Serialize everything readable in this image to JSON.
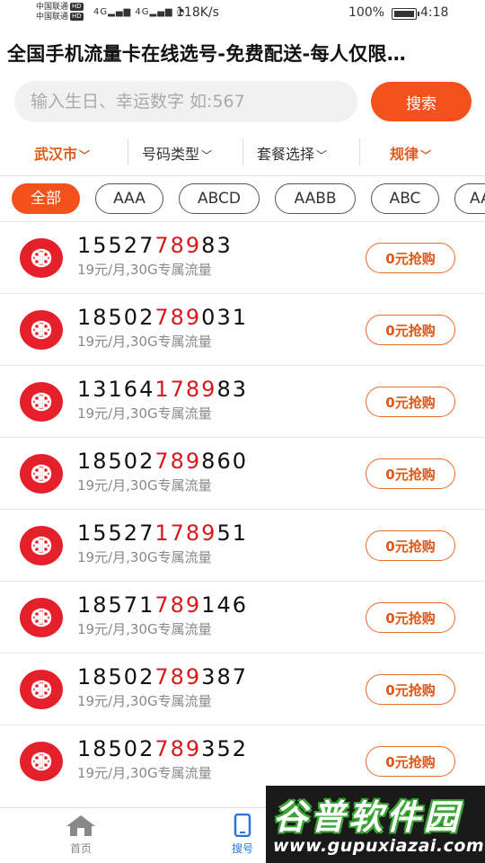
{
  "status_bar": {
    "carrier1": "中国联通",
    "carrier2": "中国联通",
    "hd": "HD",
    "net": "4G",
    "speed": "118K/s",
    "battery": "100%",
    "time": "4:18"
  },
  "title": "全国手机流量卡在线选号-免费配送-每人仅限…",
  "search": {
    "placeholder": "输入生日、幸运数字 如:567",
    "button": "搜索"
  },
  "filters": [
    {
      "label": "武汉市",
      "active": true
    },
    {
      "label": "号码类型",
      "active": false
    },
    {
      "label": "套餐选择",
      "active": false
    },
    {
      "label": "规律",
      "active": true
    }
  ],
  "chips": [
    "全部",
    "AAA",
    "ABCD",
    "AABB",
    "ABC",
    "AA"
  ],
  "rows": [
    {
      "pre": "15527",
      "hl": "789",
      "post": "83",
      "plan": "19元/月,30G专属流量",
      "btn": "0元抢购"
    },
    {
      "pre": "18502",
      "hl": "789",
      "post": "031",
      "plan": "19元/月,30G专属流量",
      "btn": "0元抢购"
    },
    {
      "pre": "13164",
      "hl": "1789",
      "post": "83",
      "plan": "19元/月,30G专属流量",
      "btn": "0元抢购"
    },
    {
      "pre": "18502",
      "hl": "789",
      "post": "860",
      "plan": "19元/月,30G专属流量",
      "btn": "0元抢购"
    },
    {
      "pre": "15527",
      "hl": "1789",
      "post": "51",
      "plan": "19元/月,30G专属流量",
      "btn": "0元抢购"
    },
    {
      "pre": "18571",
      "hl": "789",
      "post": "146",
      "plan": "19元/月,30G专属流量",
      "btn": "0元抢购"
    },
    {
      "pre": "18502",
      "hl": "789",
      "post": "387",
      "plan": "19元/月,30G专属流量",
      "btn": "0元抢购"
    },
    {
      "pre": "18502",
      "hl": "789",
      "post": "352",
      "plan": "19元/月,30G专属流量",
      "btn": "0元抢购"
    }
  ],
  "tabs": [
    {
      "label": "首页",
      "icon": "home-icon"
    },
    {
      "label": "搜号",
      "icon": "phone-icon"
    }
  ],
  "watermark": {
    "cn": "谷普软件园",
    "en": "www.gupuxiazai.com"
  },
  "colors": {
    "accent": "#f4521c",
    "highlight": "#d7191c",
    "tab_active": "#2a74d8"
  }
}
